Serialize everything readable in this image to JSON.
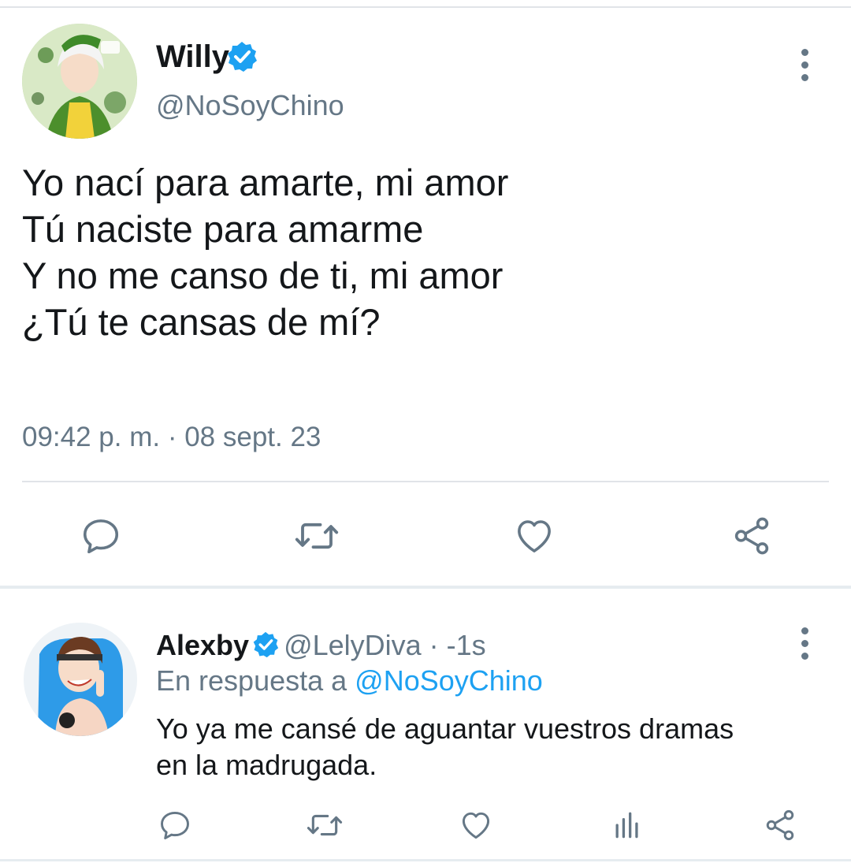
{
  "tweet": {
    "author_name": "Willy",
    "author_handle": "@NoSoyChino",
    "text_lines": [
      "Yo nací para amarte, mi amor",
      "Tú naciste para amarme",
      "Y no me canso de ti, mi amor",
      "¿Tú te cansas de mí?"
    ],
    "timestamp": "09:42 p. m. · 08 sept. 23",
    "actions": [
      "reply-icon",
      "retweet-icon",
      "like-icon",
      "share-icon"
    ]
  },
  "reply": {
    "author_name": "Alexby",
    "author_handle": "@LelyDiva",
    "time": " · -1s",
    "in_reply_prefix": "En respuesta a ",
    "in_reply_handle": "@NoSoyChino",
    "text_lines": [
      "Yo ya me cansé de aguantar vuestros dramas",
      "en la madrugada."
    ],
    "actions": [
      "reply-icon",
      "retweet-icon",
      "like-icon",
      "analytics-icon",
      "share-icon"
    ]
  },
  "colors": {
    "verified": "#1da1f2",
    "link": "#1da1f2",
    "secondary_text": "#657786",
    "icon": "#657786"
  }
}
